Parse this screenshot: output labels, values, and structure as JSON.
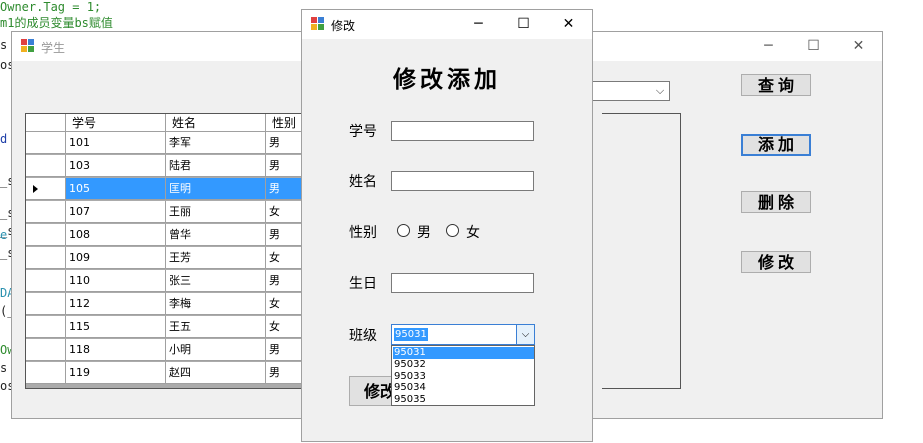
{
  "code_lines": [
    {
      "text": "Owner.Tag = 1;",
      "cls": "c-green"
    },
    {
      "text": "m1的成员变量bs赋值",
      "cls": "c-green"
    },
    {
      "text": "s",
      "cls": "c-black"
    },
    {
      "text": "os",
      "cls": "c-black"
    },
    {
      "text": "d",
      "cls": "c-navy"
    },
    {
      "text": "_s",
      "cls": "c-black"
    },
    {
      "text": "_s",
      "cls": "c-black"
    },
    {
      "text": "_s",
      "cls": "c-black"
    },
    {
      "text": "e",
      "cls": "c-blue"
    },
    {
      "text": "_s",
      "cls": "c-black"
    },
    {
      "text": "DA",
      "cls": "c-blue"
    },
    {
      "text": "(_",
      "cls": "c-black"
    },
    {
      "text": "Ow",
      "cls": "c-green"
    },
    {
      "text": "s",
      "cls": "c-black"
    },
    {
      "text": "os",
      "cls": "c-black"
    }
  ],
  "main_window": {
    "title": "学生",
    "caption_buttons": [
      "─",
      "☐",
      "✕"
    ],
    "combo_arrow": "⌵",
    "buttons": {
      "query": "查询",
      "add": "添加",
      "delete": "删除",
      "modify": "修改"
    },
    "grid": {
      "headers": [
        "学号",
        "姓名",
        "性别"
      ],
      "rows": [
        [
          "101",
          "李军",
          "男"
        ],
        [
          "103",
          "陆君",
          "男"
        ],
        [
          "105",
          "匡明",
          "男"
        ],
        [
          "107",
          "王丽",
          "女"
        ],
        [
          "108",
          "曾华",
          "男"
        ],
        [
          "109",
          "王芳",
          "女"
        ],
        [
          "110",
          "张三",
          "男"
        ],
        [
          "112",
          "李梅",
          "女"
        ],
        [
          "115",
          "王五",
          "女"
        ],
        [
          "118",
          "小明",
          "男"
        ],
        [
          "119",
          "赵四",
          "男"
        ]
      ],
      "selected_row": 2
    }
  },
  "dialog": {
    "title": "修改",
    "caption_buttons": [
      "─",
      "☐",
      "✕"
    ],
    "heading": "修改添加",
    "labels": {
      "id": "学号",
      "name": "姓名",
      "gender": "性别",
      "birthday": "生日",
      "class": "班级"
    },
    "gender_options": [
      "男",
      "女"
    ],
    "class_combo": {
      "value": "95031",
      "arrow": "⌵",
      "options": [
        "95031",
        "95032",
        "95033",
        "95034",
        "95035"
      ],
      "highlighted": 0
    },
    "submit_label": "修改"
  },
  "colors": {
    "selection": "#3399ff",
    "focus_border": "#3a7fd5",
    "window_bg": "#f0f0f0"
  }
}
